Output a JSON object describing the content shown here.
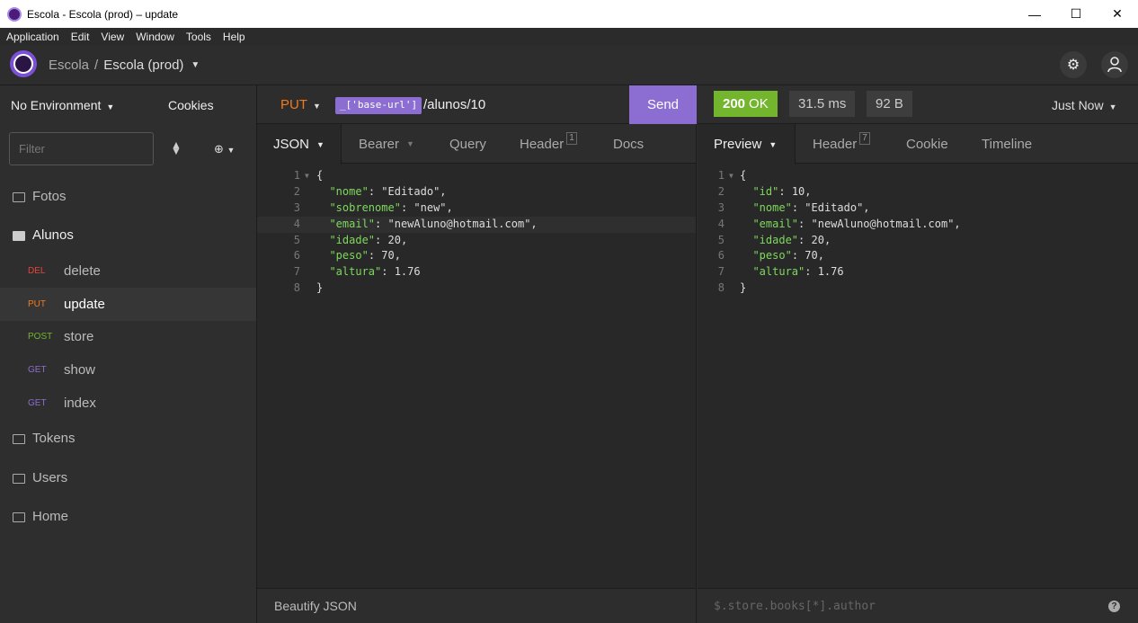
{
  "window": {
    "title": "Escola - Escola (prod) – update",
    "minimize": "—",
    "maximize": "☐",
    "close": "✕"
  },
  "menu": [
    "Application",
    "Edit",
    "View",
    "Window",
    "Tools",
    "Help"
  ],
  "header": {
    "crumb_workspace": "Escola",
    "crumb_sep": "/",
    "crumb_env": "Escola (prod)"
  },
  "sidebar": {
    "environment": "No Environment",
    "cookies": "Cookies",
    "filter_placeholder": "Filter",
    "folder_fotos": "Fotos",
    "folder_alunos": "Alunos",
    "requests": [
      {
        "method": "DEL",
        "name": "delete",
        "color": "#e5443b"
      },
      {
        "method": "PUT",
        "name": "update",
        "color": "#f27a1a"
      },
      {
        "method": "POST",
        "name": "store",
        "color": "#74b52e"
      },
      {
        "method": "GET",
        "name": "show",
        "color": "#8c6dd1"
      },
      {
        "method": "GET",
        "name": "index",
        "color": "#8c6dd1"
      }
    ],
    "folder_tokens": "Tokens",
    "folder_users": "Users",
    "folder_home": "Home"
  },
  "request": {
    "method": "PUT",
    "url_var": "_['base-url']",
    "url_path": "/alunos/10",
    "send_label": "Send",
    "tabs": {
      "json": "JSON",
      "bearer": "Bearer",
      "query": "Query",
      "header": "Header",
      "header_count": "1",
      "docs": "Docs"
    },
    "body_lines": [
      "{",
      "  \"nome\": \"Editado\",",
      "  \"sobrenome\": \"new\",",
      "  \"email\": \"newAluno@hotmail.com\",",
      "  \"idade\": 20,",
      "  \"peso\": 70,",
      "  \"altura\": 1.76",
      "}"
    ],
    "beautify_label": "Beautify JSON"
  },
  "response": {
    "status_code": "200",
    "status_text": "OK",
    "time": "31.5 ms",
    "size": "92 B",
    "when": "Just Now",
    "tabs": {
      "preview": "Preview",
      "header": "Header",
      "header_count": "7",
      "cookie": "Cookie",
      "timeline": "Timeline"
    },
    "body_lines": [
      "{",
      "  \"id\": 10,",
      "  \"nome\": \"Editado\",",
      "  \"email\": \"newAluno@hotmail.com\",",
      "  \"idade\": 20,",
      "  \"peso\": 70,",
      "  \"altura\": 1.76",
      "}"
    ],
    "filter_placeholder": "$.store.books[*].author",
    "help": "?"
  }
}
